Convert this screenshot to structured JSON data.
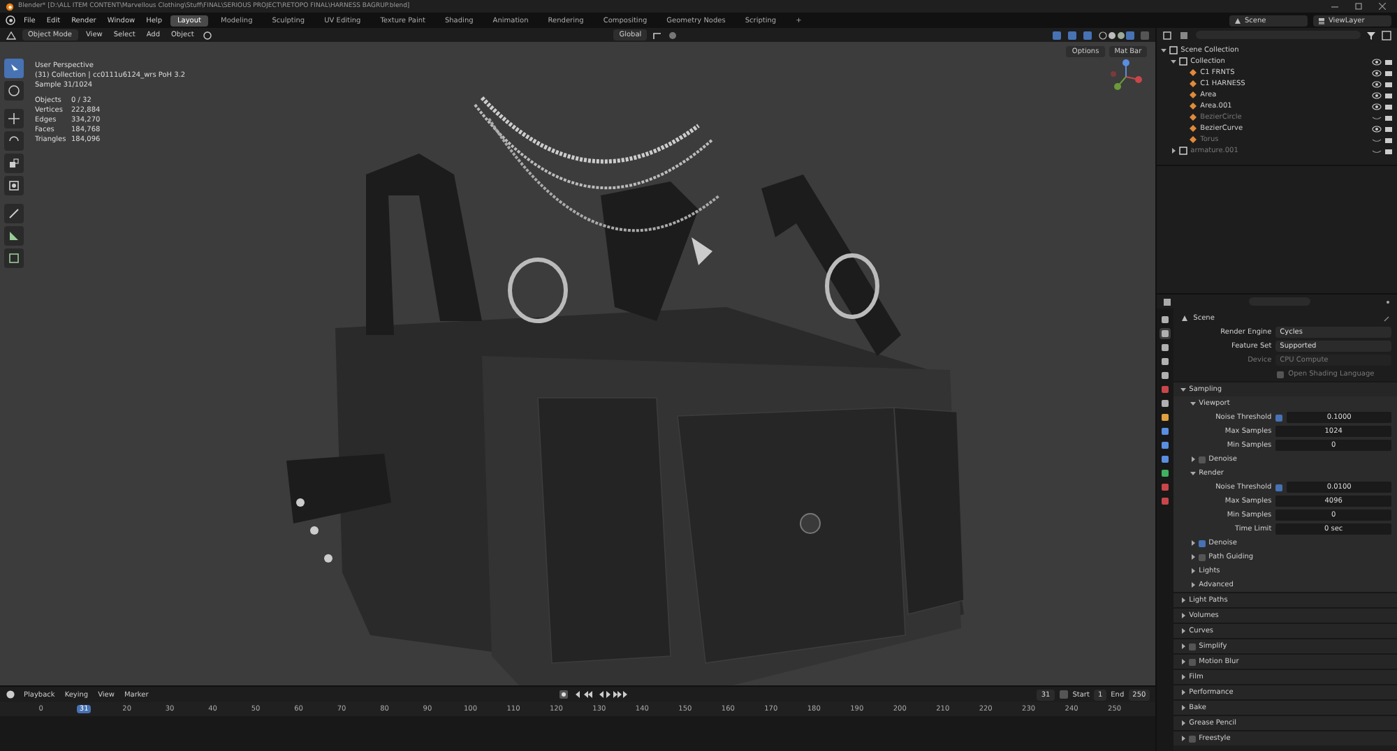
{
  "window": {
    "title": "Blender* [D:\\ALL ITEM CONTENT\\Marvellous Clothing\\Stuff\\FINAL\\SERIOUS PROJECT\\RETOPO FINAL\\HARNESS BAGRUP.blend]"
  },
  "menu": [
    "File",
    "Edit",
    "Render",
    "Window",
    "Help"
  ],
  "workspaces": [
    {
      "label": "Layout",
      "selected": true
    },
    {
      "label": "Modeling",
      "selected": false
    },
    {
      "label": "Sculpting",
      "selected": false
    },
    {
      "label": "UV Editing",
      "selected": false
    },
    {
      "label": "Texture Paint",
      "selected": false
    },
    {
      "label": "Shading",
      "selected": false
    },
    {
      "label": "Animation",
      "selected": false
    },
    {
      "label": "Rendering",
      "selected": false
    },
    {
      "label": "Compositing",
      "selected": false
    },
    {
      "label": "Geometry Nodes",
      "selected": false
    },
    {
      "label": "Scripting",
      "selected": false
    },
    {
      "label": "+",
      "selected": false
    }
  ],
  "scene": "Scene",
  "view_layer": "ViewLayer",
  "viewport_header": {
    "mode": "Object Mode",
    "menus": [
      "View",
      "Select",
      "Add",
      "Object"
    ],
    "orientation": "Global",
    "buttons": [
      "Options",
      "Mat Bar"
    ]
  },
  "tools": [
    {
      "selected": true
    },
    {
      "selected": false
    },
    {
      "selected": false
    },
    {
      "selected": false
    },
    {
      "selected": false
    },
    {
      "selected": false
    },
    {
      "selected": false
    },
    {
      "selected": false
    },
    {
      "selected": false
    }
  ],
  "overlay": {
    "lines": [
      "User Perspective",
      "(31) Collection | cc0111u6124_wrs PoH 3.2",
      "Sample 31/1024"
    ],
    "stats": [
      {
        "label": "Objects",
        "value": "0 / 32"
      },
      {
        "label": "Vertices",
        "value": "222,884"
      },
      {
        "label": "Edges",
        "value": "334,270"
      },
      {
        "label": "Faces",
        "value": "184,768"
      },
      {
        "label": "Triangles",
        "value": "184,096"
      }
    ]
  },
  "outliner": [
    {
      "name": "Scene Collection",
      "expanded": true,
      "children": [
        {
          "name": "Collection",
          "expanded": true,
          "visible": true,
          "children": [
            {
              "name": "C1 FRNTS",
              "visible": true,
              "color": "#e08a3a"
            },
            {
              "name": "C1 HARNESS",
              "visible": true,
              "color": "#e08a3a"
            },
            {
              "name": "Area",
              "visible": true,
              "color": "#e08a3a"
            },
            {
              "name": "Area.001",
              "visible": true,
              "color": "#e08a3a"
            },
            {
              "name": "BezierCircle",
              "visible": false,
              "color": "#e08a3a"
            },
            {
              "name": "BezierCurve",
              "visible": true,
              "color": "#e08a3a"
            },
            {
              "name": "Torus",
              "visible": false,
              "color": "#e08a3a"
            }
          ]
        },
        {
          "name": "armature.001",
          "expanded": false,
          "visible": false
        }
      ]
    }
  ],
  "properties": {
    "context": "Scene",
    "tabs": [
      {
        "selected": false,
        "color": "#b0b0b0"
      },
      {
        "selected": true,
        "color": "#b0b0b0"
      },
      {
        "selected": false,
        "color": "#b0b0b0"
      },
      {
        "selected": false,
        "color": "#b0b0b0"
      },
      {
        "selected": false,
        "color": "#b0b0b0"
      },
      {
        "selected": false,
        "color": "#c8464a"
      },
      {
        "selected": false,
        "color": "#b0b0b0"
      },
      {
        "selected": false,
        "color": "#e0a040"
      },
      {
        "selected": false,
        "color": "#5a8ee0"
      },
      {
        "selected": false,
        "color": "#5a8ee0"
      },
      {
        "selected": false,
        "color": "#5a8ee0"
      },
      {
        "selected": false,
        "color": "#40b060"
      },
      {
        "selected": false,
        "color": "#c8464a"
      },
      {
        "selected": false,
        "color": "#c8464a"
      }
    ],
    "items": [
      {
        "kind": "dropdown",
        "label": "Render Engine",
        "value": "Cycles",
        "disabled": false
      },
      {
        "kind": "dropdown",
        "label": "Feature Set",
        "value": "Supported",
        "disabled": false
      },
      {
        "kind": "dropdown",
        "label": "Device",
        "value": "CPU Compute",
        "disabled": true
      },
      {
        "kind": "check",
        "label": "Open Shading Language",
        "checked": false,
        "disabled": true
      },
      {
        "kind": "panel",
        "label": "Sampling",
        "expanded": true,
        "children": [
          {
            "kind": "panel",
            "label": "Viewport",
            "expanded": true,
            "children": [
              {
                "kind": "number",
                "label": "Noise Threshold",
                "value": "0.1000",
                "checked": true
              },
              {
                "kind": "number",
                "label": "Max Samples",
                "value": "1024"
              },
              {
                "kind": "number",
                "label": "Min Samples",
                "value": "0"
              },
              {
                "kind": "panel",
                "label": "Denoise",
                "expanded": false,
                "checked": false
              }
            ]
          },
          {
            "kind": "panel",
            "label": "Render",
            "expanded": true,
            "children": [
              {
                "kind": "number",
                "label": "Noise Threshold",
                "value": "0.0100",
                "checked": true
              },
              {
                "kind": "number",
                "label": "Max Samples",
                "value": "4096"
              },
              {
                "kind": "number",
                "label": "Min Samples",
                "value": "0"
              },
              {
                "kind": "number",
                "label": "Time Limit",
                "value": "0 sec"
              }
            ]
          },
          {
            "kind": "panel",
            "label": "Denoise",
            "expanded": false,
            "checked": true
          },
          {
            "kind": "panel",
            "label": "Path Guiding",
            "expanded": false,
            "checked": false
          },
          {
            "kind": "panel",
            "label": "Lights",
            "expanded": false
          },
          {
            "kind": "panel",
            "label": "Advanced",
            "expanded": false
          }
        ]
      },
      {
        "kind": "panel",
        "label": "Light Paths",
        "expanded": false
      },
      {
        "kind": "panel",
        "label": "Volumes",
        "expanded": false
      },
      {
        "kind": "panel",
        "label": "Curves",
        "expanded": false
      },
      {
        "kind": "panel",
        "label": "Simplify",
        "expanded": false,
        "checked": false
      },
      {
        "kind": "panel",
        "label": "Motion Blur",
        "expanded": false,
        "checked": false
      },
      {
        "kind": "panel",
        "label": "Film",
        "expanded": false
      },
      {
        "kind": "panel",
        "label": "Performance",
        "expanded": false
      },
      {
        "kind": "panel",
        "label": "Bake",
        "expanded": false
      },
      {
        "kind": "panel",
        "label": "Grease Pencil",
        "expanded": false
      },
      {
        "kind": "panel",
        "label": "Freestyle",
        "expanded": false,
        "checked": false
      }
    ]
  },
  "timeline": {
    "menus": [
      "Playback",
      "Keying",
      "View",
      "Marker"
    ],
    "current": "31",
    "start_label": "Start",
    "start": "1",
    "end_label": "End",
    "end": "250",
    "ticks": [
      {
        "label": "0",
        "selected": false
      },
      {
        "label": "31",
        "selected": true
      },
      {
        "label": "20",
        "selected": false
      },
      {
        "label": "30",
        "selected": false
      },
      {
        "label": "40",
        "selected": false
      },
      {
        "label": "50",
        "selected": false
      },
      {
        "label": "60",
        "selected": false
      },
      {
        "label": "70",
        "selected": false
      },
      {
        "label": "80",
        "selected": false
      },
      {
        "label": "90",
        "selected": false
      },
      {
        "label": "100",
        "selected": false
      },
      {
        "label": "110",
        "selected": false
      },
      {
        "label": "120",
        "selected": false
      },
      {
        "label": "130",
        "selected": false
      },
      {
        "label": "140",
        "selected": false
      },
      {
        "label": "150",
        "selected": false
      },
      {
        "label": "160",
        "selected": false
      },
      {
        "label": "170",
        "selected": false
      },
      {
        "label": "180",
        "selected": false
      },
      {
        "label": "190",
        "selected": false
      },
      {
        "label": "200",
        "selected": false
      },
      {
        "label": "210",
        "selected": false
      },
      {
        "label": "220",
        "selected": false
      },
      {
        "label": "230",
        "selected": false
      },
      {
        "label": "240",
        "selected": false
      },
      {
        "label": "250",
        "selected": false
      }
    ]
  }
}
